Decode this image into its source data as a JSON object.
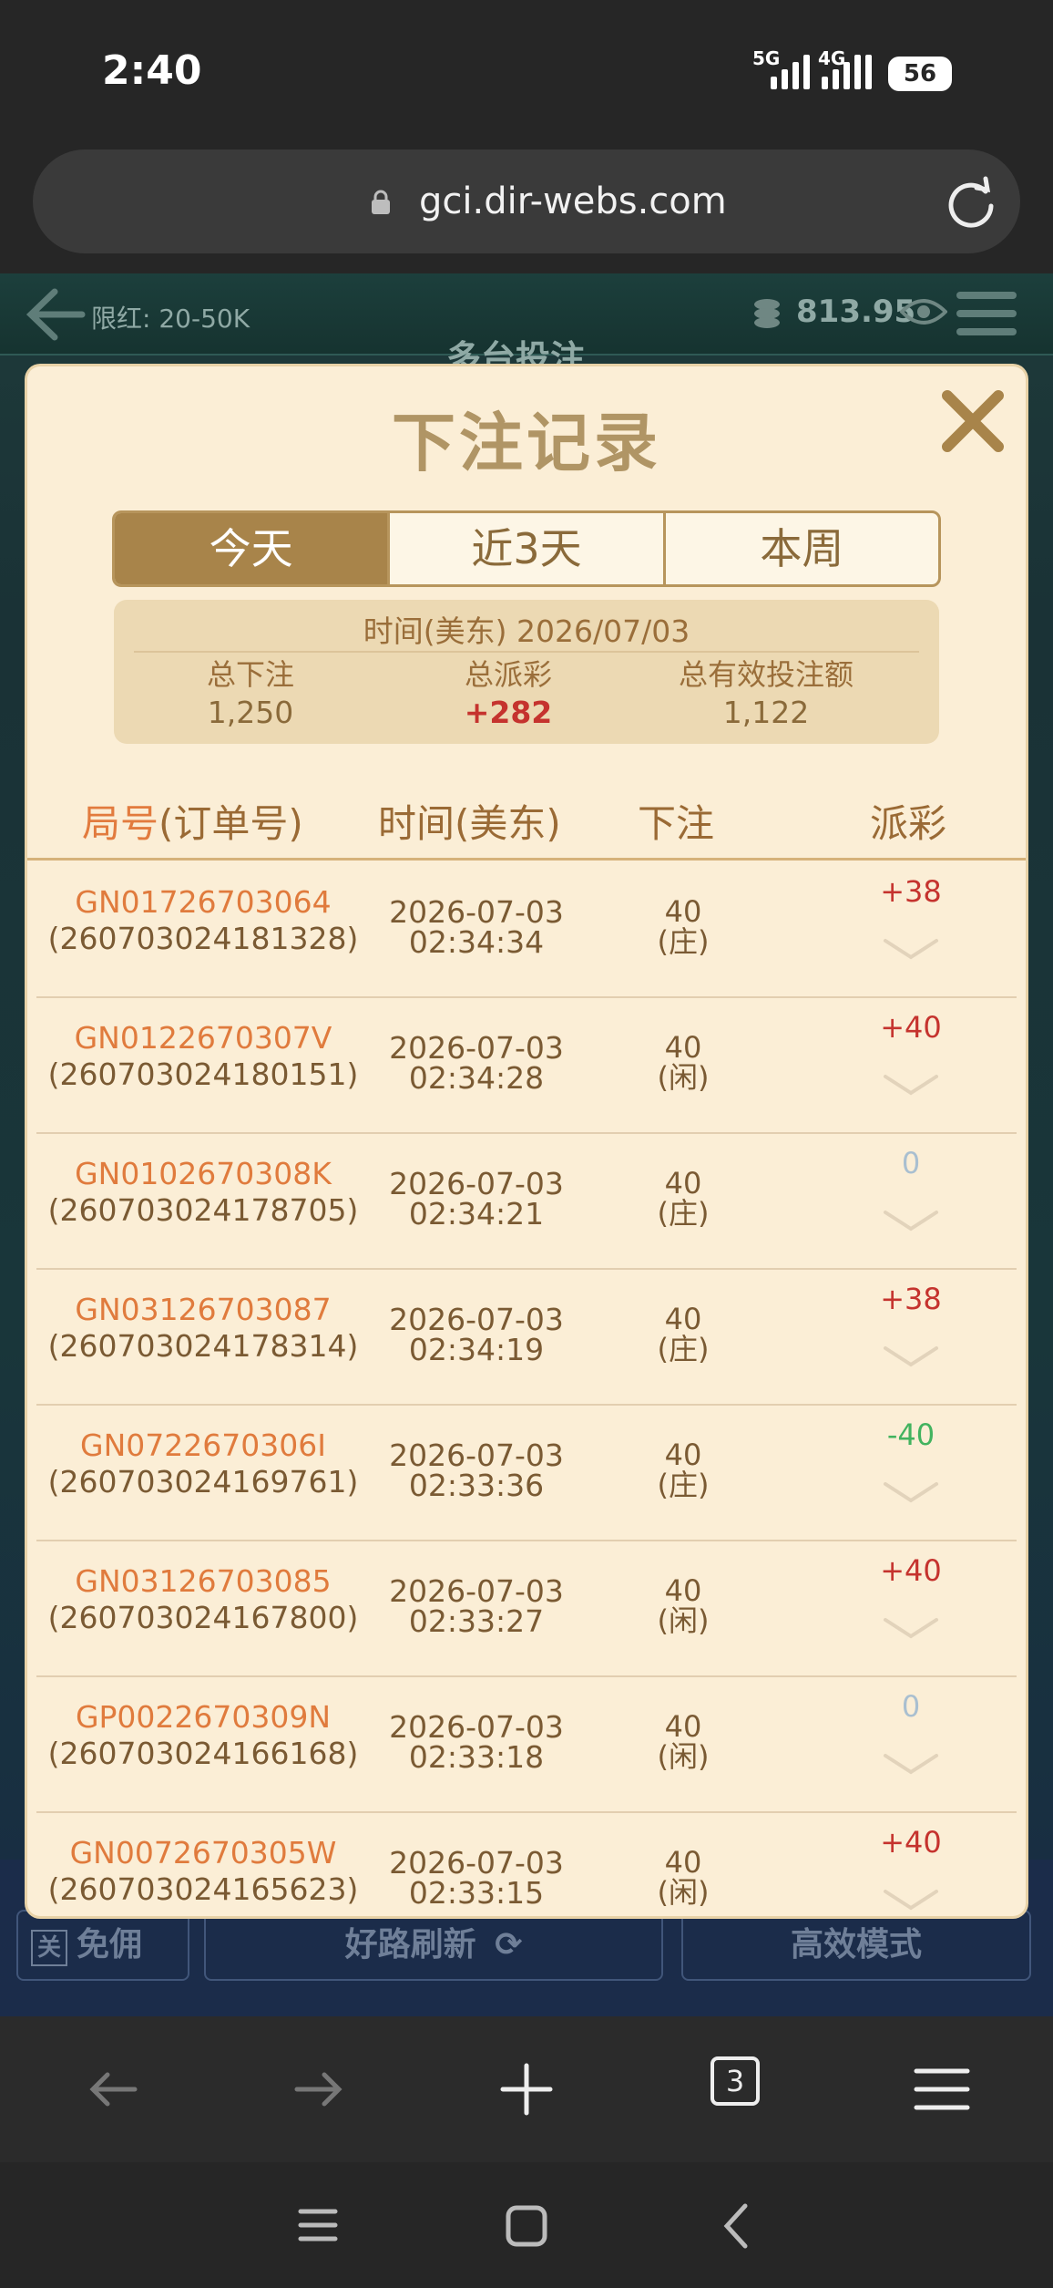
{
  "status_bar": {
    "time": "2:40",
    "net1": "5G",
    "net2": "4G",
    "battery": "56"
  },
  "browser": {
    "url": "gci.dir-webs.com",
    "tab_count": "3"
  },
  "game": {
    "limit_label": "限红: 20-50K",
    "balance": "813.95",
    "title": "多台投注",
    "btn_free": "免佣",
    "btn_free_tag": "关",
    "btn_refresh": "好路刷新",
    "btn_mode": "高效模式"
  },
  "modal": {
    "title": "下注记录",
    "tabs": [
      "今天",
      "近3天",
      "本周"
    ],
    "summary": {
      "time": "时间(美东) 2026/07/03",
      "total_bet_label": "总下注",
      "total_bet": "1,250",
      "total_payout_label": "总派彩",
      "total_payout": "+282",
      "total_valid_label": "总有效投注额",
      "total_valid": "1,122"
    },
    "headers": {
      "round_hl": "局号",
      "round_rest": "(订单号)",
      "time": "时间(美东)",
      "bet": "下注",
      "payout": "派彩"
    },
    "rows": [
      {
        "id": "GN01726703064",
        "order": "(260703024181328)",
        "date": "2026-07-03",
        "time": "02:34:34",
        "bet": "40",
        "side": "(庄)",
        "payout": "+38"
      },
      {
        "id": "GN0122670307V",
        "order": "(260703024180151)",
        "date": "2026-07-03",
        "time": "02:34:28",
        "bet": "40",
        "side": "(闲)",
        "payout": "+40"
      },
      {
        "id": "GN0102670308K",
        "order": "(260703024178705)",
        "date": "2026-07-03",
        "time": "02:34:21",
        "bet": "40",
        "side": "(庄)",
        "payout": "0"
      },
      {
        "id": "GN03126703087",
        "order": "(260703024178314)",
        "date": "2026-07-03",
        "time": "02:34:19",
        "bet": "40",
        "side": "(庄)",
        "payout": "+38"
      },
      {
        "id": "GN0722670306I",
        "order": "(260703024169761)",
        "date": "2026-07-03",
        "time": "02:33:36",
        "bet": "40",
        "side": "(庄)",
        "payout": "-40"
      },
      {
        "id": "GN03126703085",
        "order": "(260703024167800)",
        "date": "2026-07-03",
        "time": "02:33:27",
        "bet": "40",
        "side": "(闲)",
        "payout": "+40"
      },
      {
        "id": "GP0022670309N",
        "order": "(260703024166168)",
        "date": "2026-07-03",
        "time": "02:33:18",
        "bet": "40",
        "side": "(闲)",
        "payout": "0"
      },
      {
        "id": "GN0072670305W",
        "order": "(260703024165623)",
        "date": "2026-07-03",
        "time": "02:33:15",
        "bet": "40",
        "side": "(闲)",
        "payout": "+40"
      }
    ]
  },
  "colors": {
    "accent": "#a8844a",
    "positive": "#c5332e",
    "negative": "#42b35f",
    "zero": "#a9bfd0"
  }
}
